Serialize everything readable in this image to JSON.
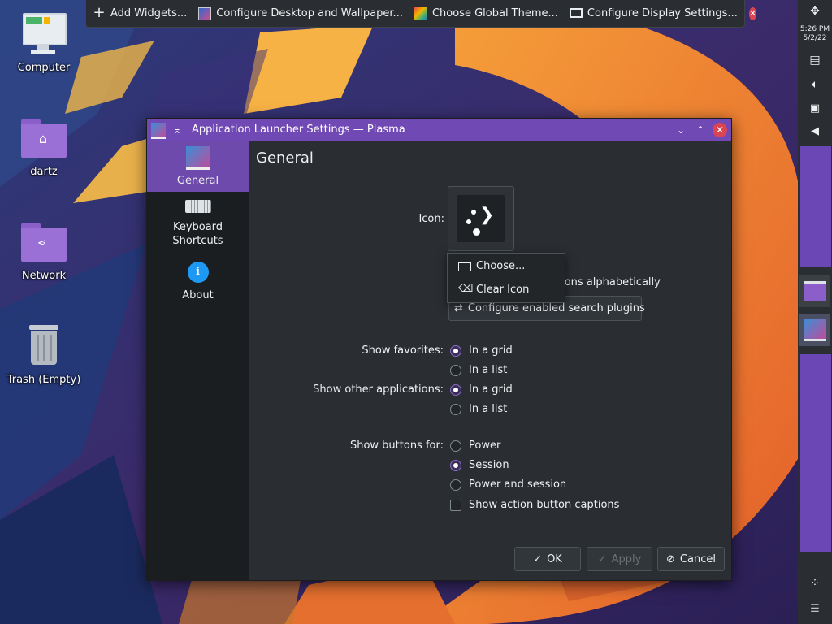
{
  "toolbar": {
    "items": [
      {
        "label": "Add Widgets...",
        "icon": "plus-icon"
      },
      {
        "label": "Configure Desktop and Wallpaper...",
        "icon": "desktop-icon"
      },
      {
        "label": "Choose Global Theme...",
        "icon": "theme-icon"
      },
      {
        "label": "Configure Display Settings...",
        "icon": "display-icon"
      }
    ],
    "close_icon": "close-icon"
  },
  "desktop_icons": {
    "computer": "Computer",
    "home": "dartz",
    "network": "Network",
    "trash": "Trash (Empty)"
  },
  "panel": {
    "time": "5:26 PM",
    "date": "5/2/22"
  },
  "dialog": {
    "title": "Application Launcher Settings — Plasma",
    "sidebar": {
      "general": "General",
      "keyboard_line1": "Keyboard",
      "keyboard_line2": "Shortcuts",
      "about": "About"
    },
    "heading": "General",
    "icon_label": "Icon:",
    "sort_text": "tions alphabetically",
    "plugins_button": "Configure enabled search plugins",
    "show_favorites_label": "Show favorites:",
    "favorites_options": [
      {
        "label": "In a grid",
        "checked": true
      },
      {
        "label": "In a list",
        "checked": false
      }
    ],
    "show_other_label": "Show other applications:",
    "other_options": [
      {
        "label": "In a grid",
        "checked": true
      },
      {
        "label": "In a list",
        "checked": false
      }
    ],
    "show_buttons_label": "Show buttons for:",
    "buttons_options": [
      {
        "label": "Power",
        "checked": false
      },
      {
        "label": "Session",
        "checked": true
      },
      {
        "label": "Power and session",
        "checked": false
      }
    ],
    "captions_checkbox": {
      "label": "Show action button captions",
      "checked": false
    },
    "ok": "OK",
    "apply": "Apply",
    "cancel": "Cancel"
  },
  "icon_menu": {
    "choose": "Choose...",
    "clear": "Clear Icon"
  },
  "colors": {
    "accent": "#7149b4",
    "selected_sidebar": "#6d4aab",
    "window_bg": "#2a2e32",
    "close_red": "#da4453"
  }
}
